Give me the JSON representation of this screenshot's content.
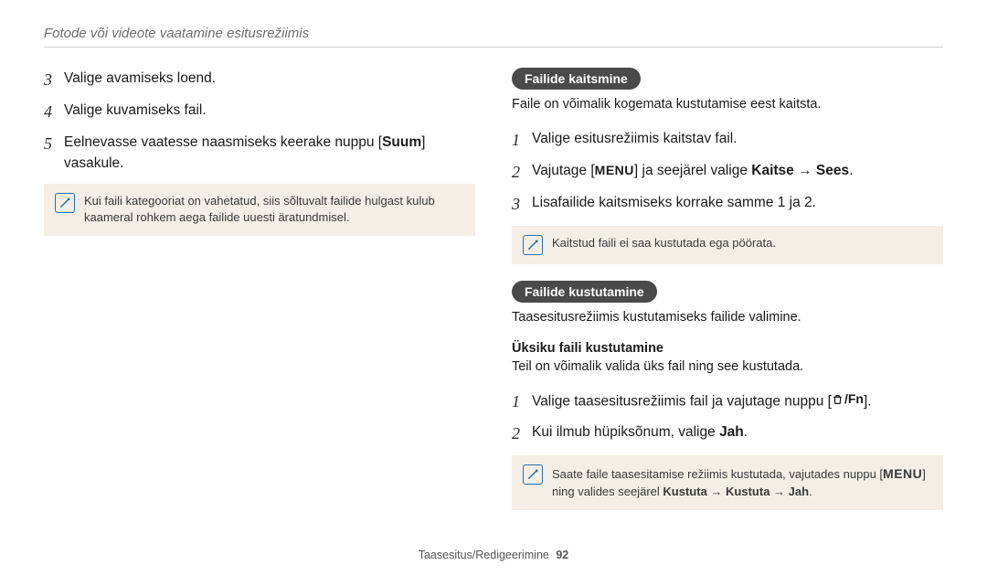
{
  "header": "Fotode või videote vaatamine esitusrežiimis",
  "left": {
    "steps": [
      {
        "num": "3",
        "text": "Valige avamiseks loend."
      },
      {
        "num": "4",
        "text": "Valige kuvamiseks fail."
      },
      {
        "num": "5",
        "prefix": "Eelnevasse vaatesse naasmiseks keerake nuppu [",
        "bold": "Suum",
        "suffix": "] vasakule."
      }
    ],
    "note": "Kui faili kategooriat on vahetatud, siis sõltuvalt failide hulgast kulub kaameral rohkem aega failide uuesti äratundmisel."
  },
  "right": {
    "protect": {
      "title": "Failide kaitsmine",
      "intro": "Faile on võimalik kogemata kustutamise eest kaitsta.",
      "steps": [
        {
          "num": "1",
          "text": "Valige esitusrežiimis kaitstav fail."
        },
        {
          "num": "2",
          "prefix": "Vajutage [",
          "menu": "MENU",
          "mid": "] ja seejärel valige ",
          "bold1": "Kaitse",
          "arrow": " → ",
          "bold2": "Sees",
          "suffix": "."
        },
        {
          "num": "3",
          "text": "Lisafailide kaitsmiseks korrake samme 1 ja 2."
        }
      ],
      "note": "Kaitstud faili ei saa kustutada ega pöörata."
    },
    "delete": {
      "title": "Failide kustutamine",
      "intro": "Taasesitusrežiimis kustutamiseks failide valimine.",
      "single_title": "Üksiku faili kustutamine",
      "single_intro": "Teil on võimalik valida üks fail ning see kustutada.",
      "steps": [
        {
          "num": "1",
          "prefix": "Valige taasesitusrežiimis fail ja vajutage nuppu [",
          "icon": "trash",
          "fn": "/Fn",
          "suffix": "]."
        },
        {
          "num": "2",
          "prefix": "Kui ilmub hüpiksõnum, valige ",
          "bold": "Jah",
          "suffix": "."
        }
      ],
      "note_prefix": "Saate faile taasesitamise režiimis kustutada, vajutades nuppu [",
      "note_menu": "MENU",
      "note_mid": "] ning valides seejärel ",
      "note_b1": "Kustuta",
      "note_arrow1": " → ",
      "note_b2": "Kustuta",
      "note_arrow2": " → ",
      "note_b3": "Jah",
      "note_suffix": "."
    }
  },
  "footer": {
    "section": "Taasesitus/Redigeerimine",
    "page": "92"
  }
}
